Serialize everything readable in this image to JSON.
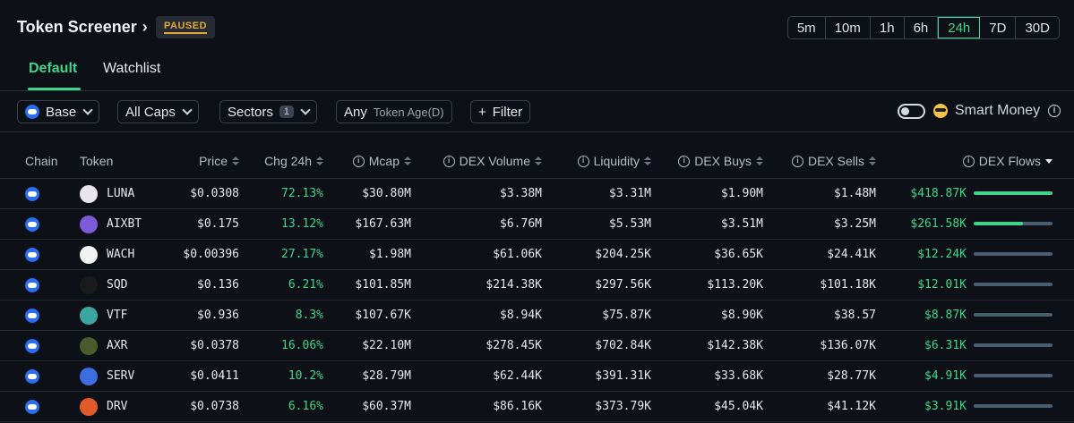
{
  "header": {
    "title": "Token Screener",
    "status_badge": "PAUSED",
    "timeframes": [
      "5m",
      "10m",
      "1h",
      "6h",
      "24h",
      "7D",
      "30D"
    ],
    "active_timeframe": "24h"
  },
  "tabs": [
    {
      "label": "Default",
      "active": true
    },
    {
      "label": "Watchlist",
      "active": false
    }
  ],
  "filters": {
    "chain": "Base",
    "caps": "All Caps",
    "sectors": "Sectors",
    "sectors_count": "1",
    "token_age_value": "Any",
    "token_age_label": "Token Age(D)",
    "filter_button": "Filter",
    "smart_money_label": "Smart Money",
    "smart_money_enabled": false
  },
  "table": {
    "headers": {
      "chain": "Chain",
      "token": "Token",
      "price": "Price",
      "chg": "Chg 24h",
      "mcap": "Mcap",
      "dex_volume": "DEX Volume",
      "liquidity": "Liquidity",
      "dex_buys": "DEX Buys",
      "dex_sells": "DEX Sells",
      "dex_flows": "DEX Flows"
    },
    "rows": [
      {
        "token": "LUNA",
        "price": "$0.0308",
        "chg": "72.13%",
        "mcap": "$30.80M",
        "dex_volume": "$3.38M",
        "liquidity": "$3.31M",
        "dex_buys": "$1.90M",
        "dex_sells": "$1.48M",
        "dex_flows": "$418.87K",
        "flow_fraction": 1.0,
        "avatar_color": "#e9e4f0"
      },
      {
        "token": "AIXBT",
        "price": "$0.175",
        "chg": "13.12%",
        "mcap": "$167.63M",
        "dex_volume": "$6.76M",
        "liquidity": "$5.53M",
        "dex_buys": "$3.51M",
        "dex_sells": "$3.25M",
        "dex_flows": "$261.58K",
        "flow_fraction": 0.62,
        "avatar_color": "#7b5bd6"
      },
      {
        "token": "WACH",
        "price": "$0.00396",
        "chg": "27.17%",
        "mcap": "$1.98M",
        "dex_volume": "$61.06K",
        "liquidity": "$204.25K",
        "dex_buys": "$36.65K",
        "dex_sells": "$24.41K",
        "dex_flows": "$12.24K",
        "flow_fraction": 0.0,
        "avatar_color": "#f2f2f2"
      },
      {
        "token": "SQD",
        "price": "$0.136",
        "chg": "6.21%",
        "mcap": "$101.85M",
        "dex_volume": "$214.38K",
        "liquidity": "$297.56K",
        "dex_buys": "$113.20K",
        "dex_sells": "$101.18K",
        "dex_flows": "$12.01K",
        "flow_fraction": 0.0,
        "avatar_color": "#1a1a1a"
      },
      {
        "token": "VTF",
        "price": "$0.936",
        "chg": "8.3%",
        "mcap": "$107.67K",
        "dex_volume": "$8.94K",
        "liquidity": "$75.87K",
        "dex_buys": "$8.90K",
        "dex_sells": "$38.57",
        "dex_flows": "$8.87K",
        "flow_fraction": 0.0,
        "avatar_color": "#3aa7a0"
      },
      {
        "token": "AXR",
        "price": "$0.0378",
        "chg": "16.06%",
        "mcap": "$22.10M",
        "dex_volume": "$278.45K",
        "liquidity": "$702.84K",
        "dex_buys": "$142.38K",
        "dex_sells": "$136.07K",
        "dex_flows": "$6.31K",
        "flow_fraction": 0.0,
        "avatar_color": "#4a5a2a"
      },
      {
        "token": "SERV",
        "price": "$0.0411",
        "chg": "10.2%",
        "mcap": "$28.79M",
        "dex_volume": "$62.44K",
        "liquidity": "$391.31K",
        "dex_buys": "$33.68K",
        "dex_sells": "$28.77K",
        "dex_flows": "$4.91K",
        "flow_fraction": 0.0,
        "avatar_color": "#3d6de0"
      },
      {
        "token": "DRV",
        "price": "$0.0738",
        "chg": "6.16%",
        "mcap": "$60.37M",
        "dex_volume": "$86.16K",
        "liquidity": "$373.79K",
        "dex_buys": "$45.04K",
        "dex_sells": "$41.12K",
        "dex_flows": "$3.91K",
        "flow_fraction": 0.0,
        "avatar_color": "#e05a2a"
      }
    ]
  },
  "colors": {
    "accent": "#3fd58a",
    "background": "#0d1117",
    "paused": "#e0a93a",
    "base_chain": "#2b6df0"
  }
}
